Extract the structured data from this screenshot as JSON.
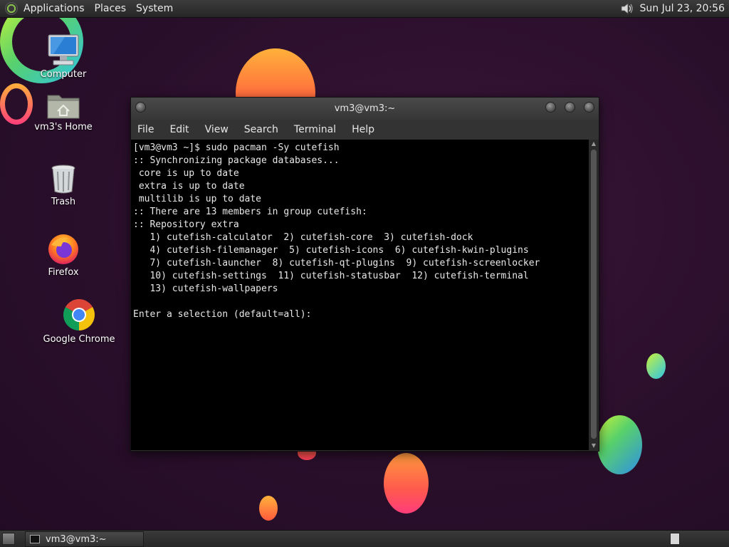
{
  "top_panel": {
    "menus": [
      "Applications",
      "Places",
      "System"
    ],
    "clock": "Sun Jul 23, 20:56",
    "icons": {
      "logo": "mate-logo-icon",
      "volume": "volume-icon"
    }
  },
  "desktop_icons": [
    {
      "label": "Computer",
      "icon": "computer-icon"
    },
    {
      "label": "vm3's Home",
      "icon": "home-folder-icon"
    },
    {
      "label": "Trash",
      "icon": "trash-icon"
    },
    {
      "label": "Firefox",
      "icon": "firefox-icon"
    },
    {
      "label": "Google Chrome",
      "icon": "chrome-icon"
    }
  ],
  "terminal": {
    "title": "vm3@vm3:~",
    "menus": [
      "File",
      "Edit",
      "View",
      "Search",
      "Terminal",
      "Help"
    ],
    "lines": [
      "[vm3@vm3 ~]$ sudo pacman -Sy cutefish",
      ":: Synchronizing package databases...",
      " core is up to date",
      " extra is up to date",
      " multilib is up to date",
      ":: There are 13 members in group cutefish:",
      ":: Repository extra",
      "   1) cutefish-calculator  2) cutefish-core  3) cutefish-dock",
      "   4) cutefish-filemanager  5) cutefish-icons  6) cutefish-kwin-plugins",
      "   7) cutefish-launcher  8) cutefish-qt-plugins  9) cutefish-screenlocker",
      "   10) cutefish-settings  11) cutefish-statusbar  12) cutefish-terminal",
      "   13) cutefish-wallpapers",
      "",
      "Enter a selection (default=all): "
    ]
  },
  "bottom_panel": {
    "task": "vm3@vm3:~",
    "icons": {
      "show_desktop": "show-desktop-icon",
      "workspace": "workspace-switcher-icon"
    }
  },
  "colors": {
    "wallpaper": "#2a0f2b",
    "terminal_bg": "#000000",
    "terminal_fg": "#e8e8e8",
    "panel": "#2e2e2e"
  }
}
